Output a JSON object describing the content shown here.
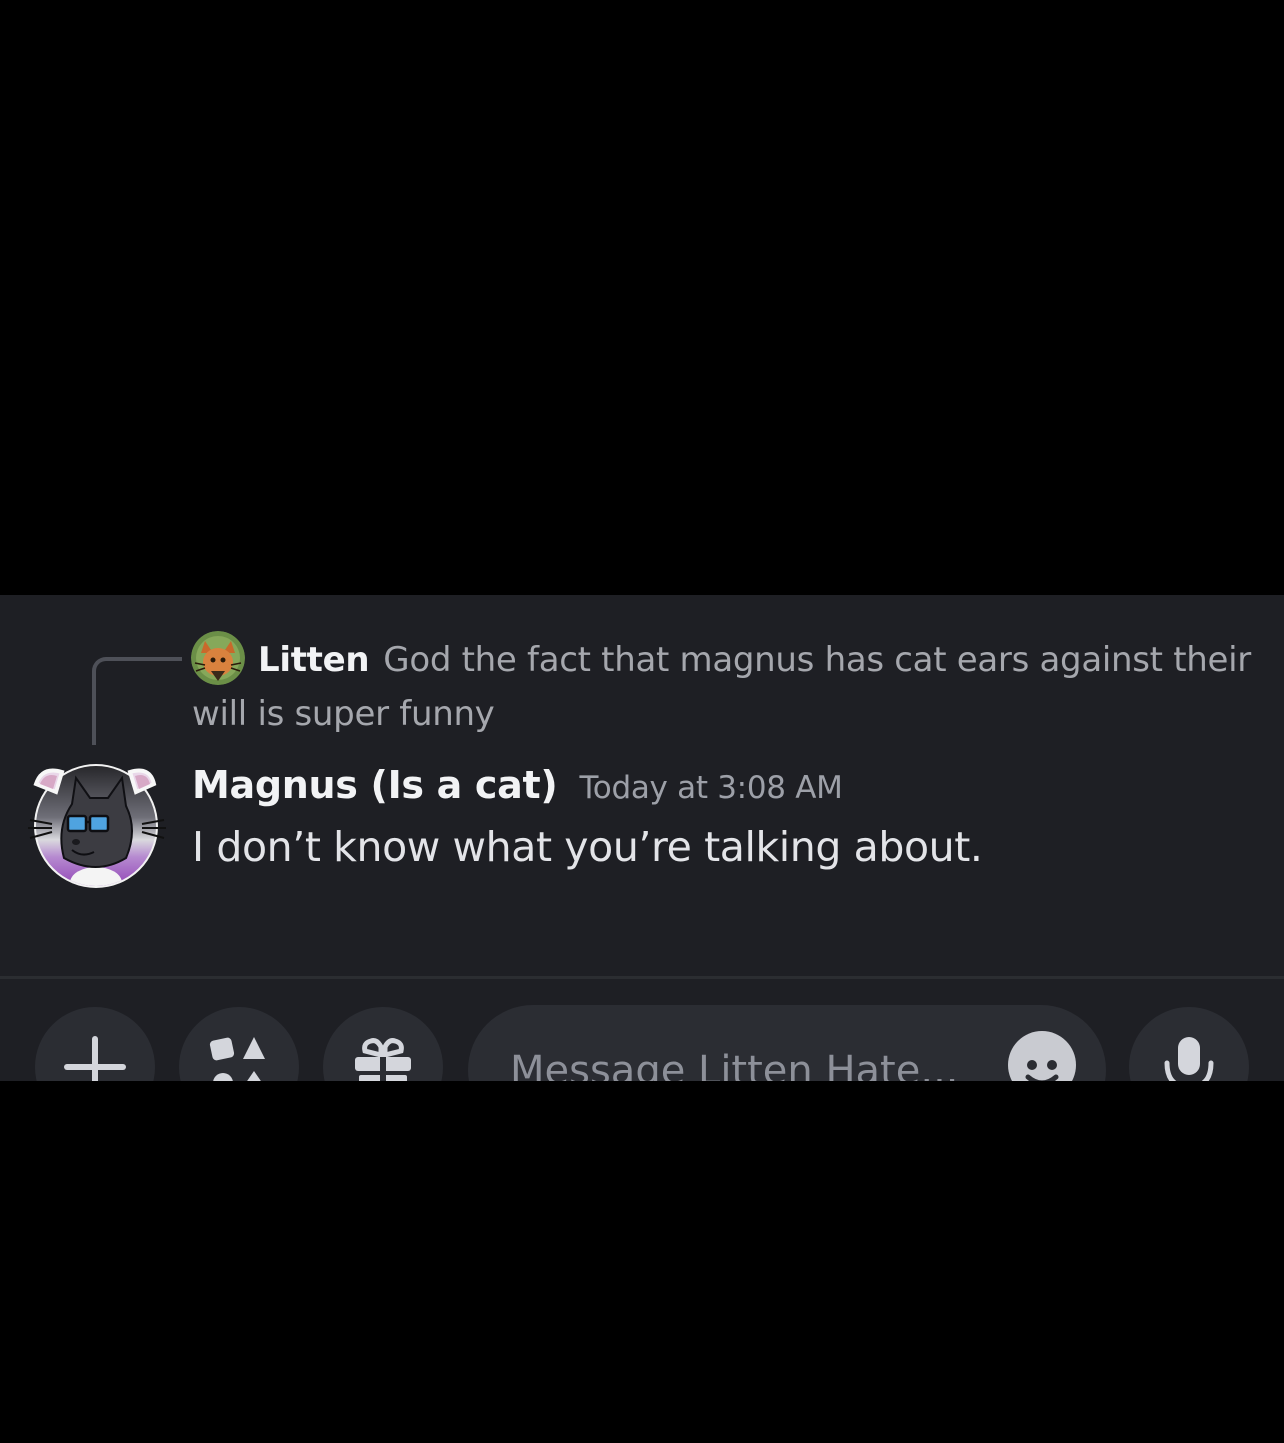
{
  "reply": {
    "author": "Litten",
    "text": "God the fact that magnus has cat ears against their will is super funny"
  },
  "message": {
    "author": "Magnus (Is a cat)",
    "timestamp": "Today at 3:08 AM",
    "text": "I don’t know what you’re talking about."
  },
  "composer": {
    "placeholder": "Message Litten Hate...",
    "buttons": [
      "plus-icon",
      "apps-icon",
      "gift-icon",
      "emoji-icon",
      "microphone-icon"
    ]
  },
  "colors": {
    "background": "#000000",
    "chat_background": "#1e1f24",
    "button_background": "#2b2d33",
    "author_text": "#f2f3f5",
    "muted_text": "#a5a7ad",
    "avatar_accent": "#a15bc4"
  }
}
